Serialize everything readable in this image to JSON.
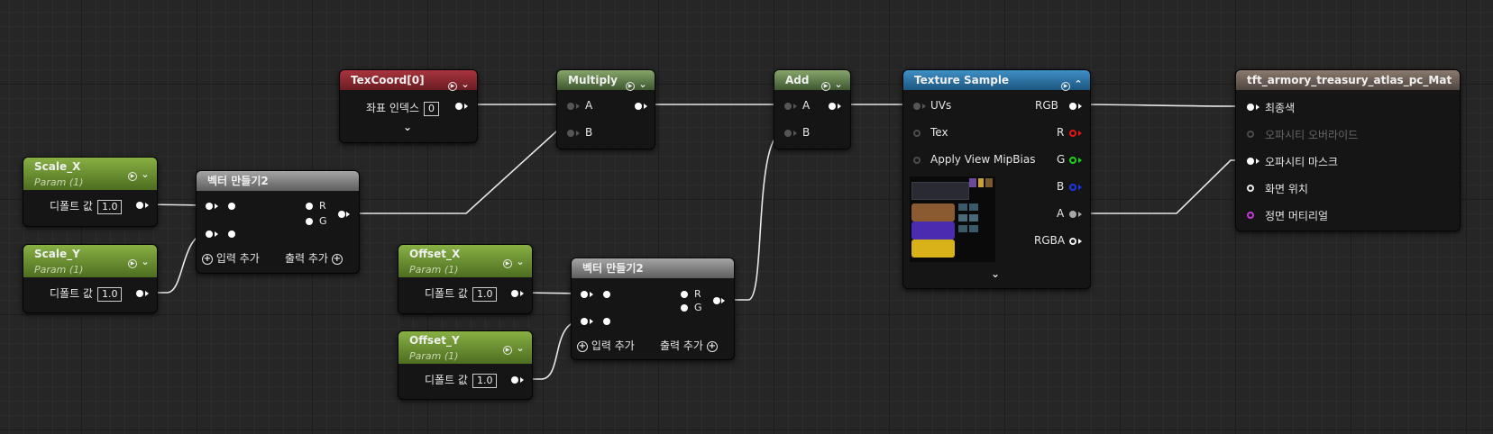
{
  "nodes": {
    "texcoord": {
      "title": "TexCoord[0]",
      "coord_label": "좌표 인덱스",
      "coord_value": "0"
    },
    "multiply": {
      "title": "Multiply",
      "in_a": "A",
      "in_b": "B"
    },
    "add": {
      "title": "Add",
      "in_a": "A",
      "in_b": "B"
    },
    "texture_sample": {
      "title": "Texture Sample",
      "inputs": [
        "UVs",
        "Tex",
        "Apply View MipBias"
      ],
      "outputs": [
        "RGB",
        "R",
        "G",
        "B",
        "A",
        "RGBA"
      ]
    },
    "material": {
      "title": "tft_armory_treasury_atlas_pc_Mat",
      "inputs": [
        "최종색",
        "오파시티 오버라이드",
        "오파시티 마스크",
        "화면 위치",
        "정면 머티리얼"
      ]
    },
    "scale_x": {
      "title": "Scale_X",
      "subtitle": "Param (1)",
      "label": "디폴트 값",
      "value": "1.0"
    },
    "scale_y": {
      "title": "Scale_Y",
      "subtitle": "Param (1)",
      "label": "디폴트 값",
      "value": "1.0"
    },
    "offset_x": {
      "title": "Offset_X",
      "subtitle": "Param (1)",
      "label": "디폴트 값",
      "value": "1.0"
    },
    "offset_y": {
      "title": "Offset_Y",
      "subtitle": "Param (1)",
      "label": "디폴트 값",
      "value": "1.0"
    },
    "make_vector_1": {
      "title": "벡터 만들기2",
      "out_r": "R",
      "out_g": "G",
      "add_input": "입력 추가",
      "add_output": "출력 추가"
    },
    "make_vector_2": {
      "title": "벡터 만들기2",
      "out_r": "R",
      "out_g": "G",
      "add_input": "입력 추가",
      "add_output": "출력 추가"
    }
  },
  "colors": {
    "canvas_bg": "#262626",
    "header_red": "#a8343d",
    "header_green": "#86a66a",
    "header_param": "#88b044",
    "header_blue": "#3f8fc6",
    "pin_red": "#e21515",
    "pin_green": "#1bd31b",
    "pin_blue": "#1c37e8",
    "pin_magenta": "#c53ad8"
  },
  "icons": [
    "play-circle-icon",
    "chevron-down-icon",
    "chevron-up-icon",
    "plus-circle-icon"
  ]
}
